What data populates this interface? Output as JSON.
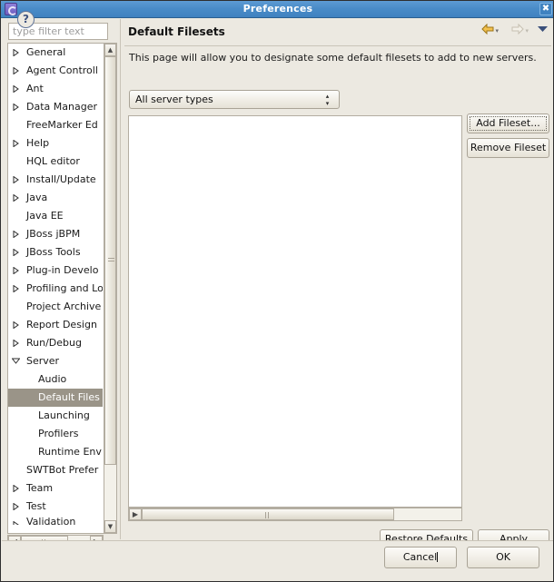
{
  "window": {
    "title": "Preferences",
    "app_icon": "eclipse-icon",
    "close_icon": "close-icon",
    "titlebar_color": "#4a8cc8",
    "background_color": "#ece9e1",
    "selection_color": "#9a9488"
  },
  "sidebar": {
    "filter": {
      "placeholder": "type filter text",
      "value": ""
    },
    "items": [
      {
        "label": "General",
        "level": 0,
        "expandable": true,
        "expanded": false,
        "selected": false
      },
      {
        "label": "Agent Controll",
        "level": 0,
        "expandable": true,
        "expanded": false,
        "selected": false
      },
      {
        "label": "Ant",
        "level": 0,
        "expandable": true,
        "expanded": false,
        "selected": false
      },
      {
        "label": "Data Manager",
        "level": 0,
        "expandable": true,
        "expanded": false,
        "selected": false
      },
      {
        "label": "FreeMarker Ed",
        "level": 0,
        "expandable": false,
        "expanded": false,
        "selected": false
      },
      {
        "label": "Help",
        "level": 0,
        "expandable": true,
        "expanded": false,
        "selected": false
      },
      {
        "label": "HQL editor",
        "level": 0,
        "expandable": false,
        "expanded": false,
        "selected": false
      },
      {
        "label": "Install/Update",
        "level": 0,
        "expandable": true,
        "expanded": false,
        "selected": false
      },
      {
        "label": "Java",
        "level": 0,
        "expandable": true,
        "expanded": false,
        "selected": false
      },
      {
        "label": "Java EE",
        "level": 0,
        "expandable": false,
        "expanded": false,
        "selected": false
      },
      {
        "label": "JBoss jBPM",
        "level": 0,
        "expandable": true,
        "expanded": false,
        "selected": false
      },
      {
        "label": "JBoss Tools",
        "level": 0,
        "expandable": true,
        "expanded": false,
        "selected": false
      },
      {
        "label": "Plug-in Develo",
        "level": 0,
        "expandable": true,
        "expanded": false,
        "selected": false
      },
      {
        "label": "Profiling and Lo",
        "level": 0,
        "expandable": true,
        "expanded": false,
        "selected": false
      },
      {
        "label": "Project Archive",
        "level": 0,
        "expandable": false,
        "expanded": false,
        "selected": false
      },
      {
        "label": "Report Design",
        "level": 0,
        "expandable": true,
        "expanded": false,
        "selected": false
      },
      {
        "label": "Run/Debug",
        "level": 0,
        "expandable": true,
        "expanded": false,
        "selected": false
      },
      {
        "label": "Server",
        "level": 0,
        "expandable": true,
        "expanded": true,
        "selected": false
      },
      {
        "label": "Audio",
        "level": 1,
        "expandable": false,
        "expanded": false,
        "selected": false
      },
      {
        "label": "Default Files",
        "level": 1,
        "expandable": false,
        "expanded": false,
        "selected": true
      },
      {
        "label": "Launching",
        "level": 1,
        "expandable": false,
        "expanded": false,
        "selected": false
      },
      {
        "label": "Profilers",
        "level": 1,
        "expandable": false,
        "expanded": false,
        "selected": false
      },
      {
        "label": "Runtime Env",
        "level": 1,
        "expandable": false,
        "expanded": false,
        "selected": false
      },
      {
        "label": "SWTBot Prefer",
        "level": 0,
        "expandable": false,
        "expanded": false,
        "selected": false
      },
      {
        "label": "Team",
        "level": 0,
        "expandable": true,
        "expanded": false,
        "selected": false
      },
      {
        "label": "Test",
        "level": 0,
        "expandable": true,
        "expanded": false,
        "selected": false
      },
      {
        "label": "Validation",
        "level": 0,
        "expandable": true,
        "expanded": false,
        "selected": false,
        "clipped": true
      }
    ],
    "vscroll": {
      "up_icon": "scroll-up-icon",
      "down_icon": "scroll-down-icon"
    },
    "hscroll": {
      "left_icon": "scroll-left-icon",
      "right_icon": "scroll-right-icon"
    }
  },
  "page": {
    "title": "Default Filesets",
    "description": "This page will allow you to designate some default filesets to add to new servers.",
    "nav": {
      "back_icon": "back-arrow-icon",
      "forward_icon": "forward-arrow-icon",
      "menu_icon": "dropdown-triangle-icon",
      "back_enabled": true,
      "forward_enabled": false
    },
    "server_type_combo": {
      "value": "All server types",
      "options": [
        "All server types"
      ],
      "stepper_up": "▴",
      "stepper_down": "▾"
    },
    "fileset_list": {
      "items": []
    },
    "buttons": {
      "add_fileset": "Add Fileset...",
      "remove_fileset": "Remove Fileset",
      "restore_defaults_pre": "Restore ",
      "restore_defaults_mn": "D",
      "restore_defaults_post": "efaults",
      "apply_mn": "A",
      "apply_post": "pply"
    },
    "list_hscroll": {
      "left_icon": "scroll-left-icon",
      "right_icon": "scroll-right-icon"
    }
  },
  "footer": {
    "help_icon": "help-question-icon",
    "cancel": "Cancel",
    "ok": "OK"
  }
}
